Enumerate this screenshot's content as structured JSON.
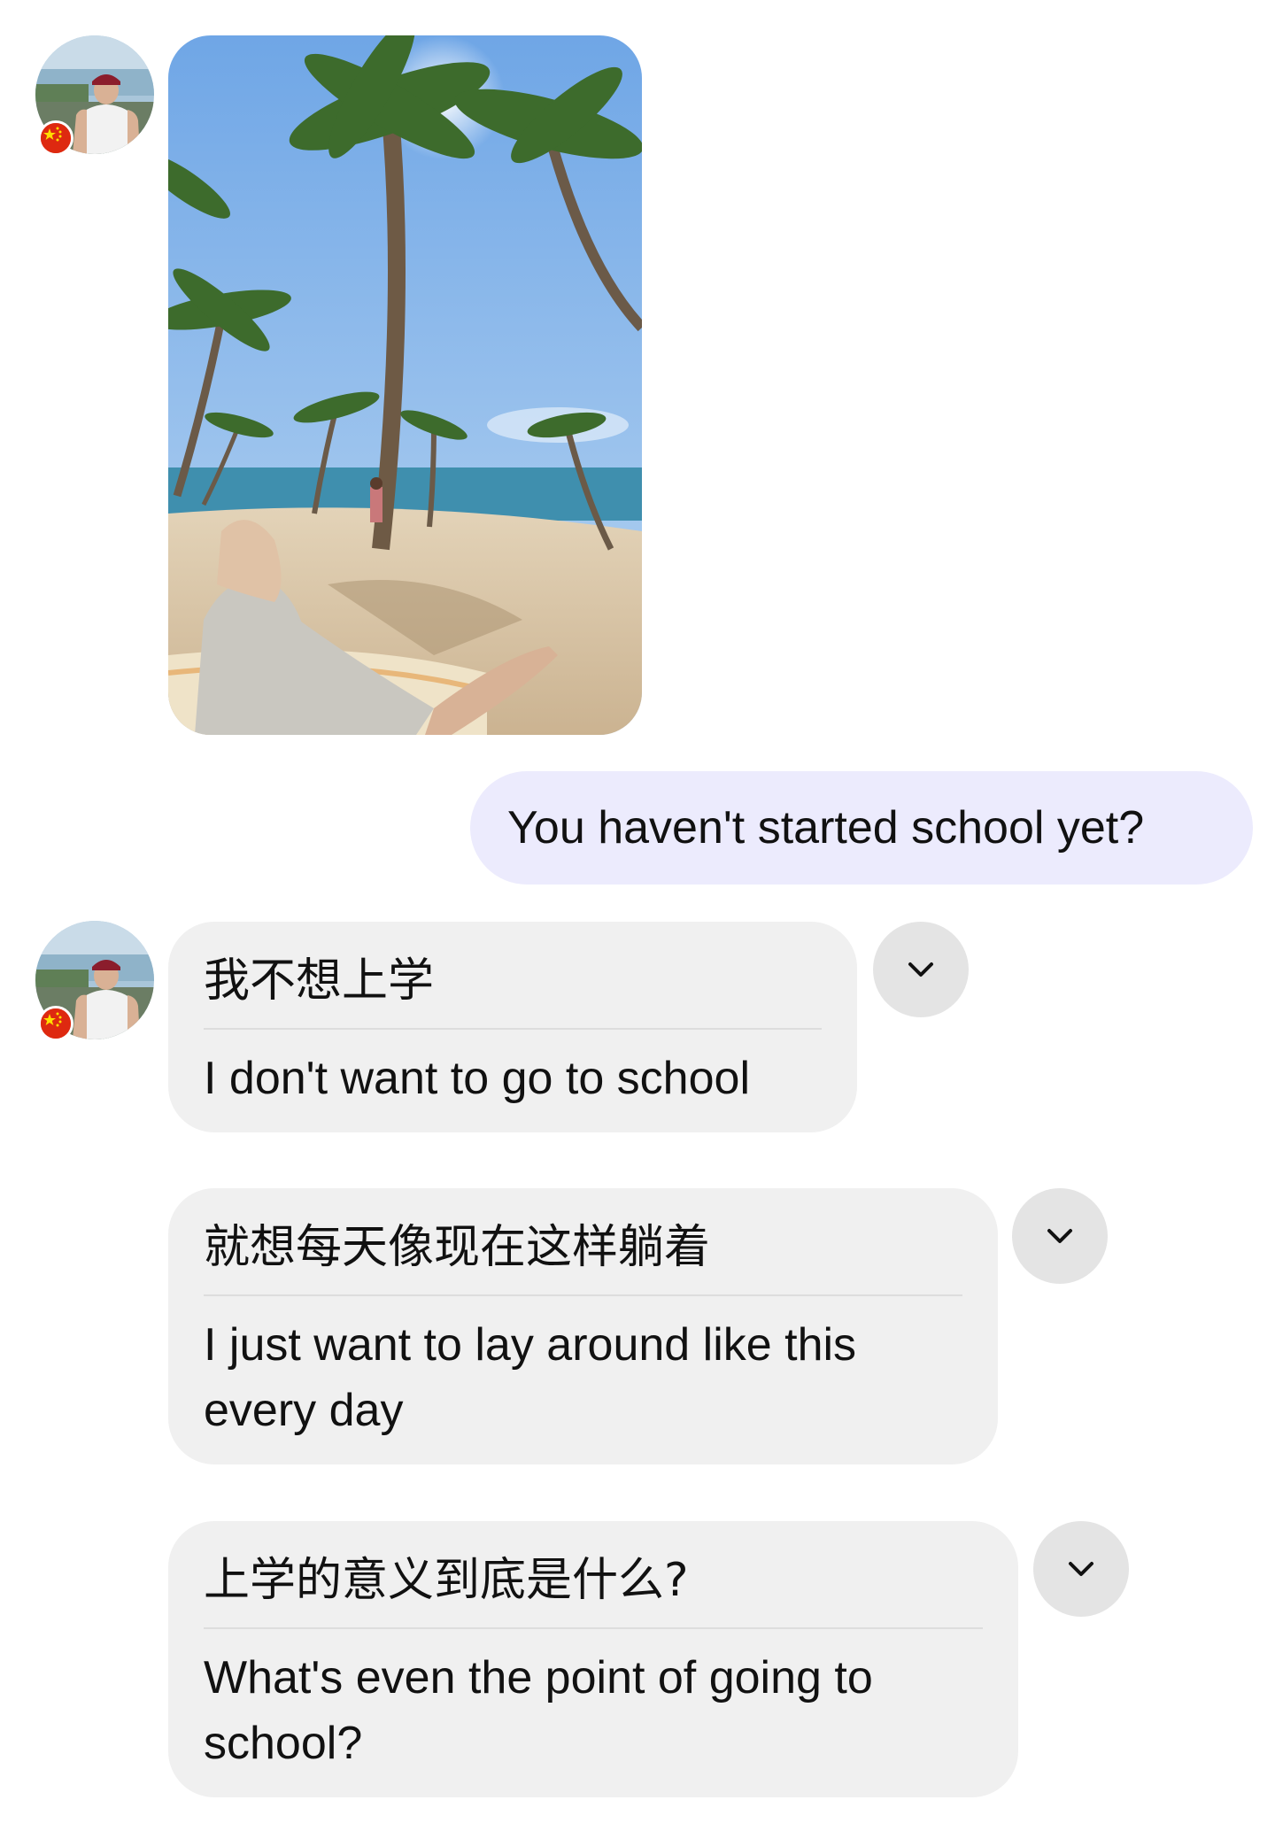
{
  "conversation": {
    "messages": [
      {
        "type": "image",
        "sender": "contact",
        "image_alt": "beach-with-palm-trees-photo"
      },
      {
        "type": "text",
        "sender": "me",
        "text": "You haven't started school yet?"
      },
      {
        "type": "translated",
        "sender": "contact",
        "original": "我不想上学",
        "translation": "I don't want to go to school"
      },
      {
        "type": "translated",
        "sender": "contact",
        "original": "就想每天像现在这样躺着",
        "translation": "I just want to lay around like this every day"
      },
      {
        "type": "translated",
        "sender": "contact",
        "original": "上学的意义到底是什么?",
        "translation": "What's even the point of going to school?"
      }
    ]
  },
  "contact": {
    "avatar_icon": "profile-photo",
    "flag_icon": "china-flag-icon",
    "flag_colors": {
      "red": "#de2910",
      "star": "#ffde00"
    }
  },
  "colors": {
    "outgoing_bubble": "#ecebfd",
    "incoming_bubble": "#f0f0f0",
    "chevron_button": "#e4e4e4"
  }
}
